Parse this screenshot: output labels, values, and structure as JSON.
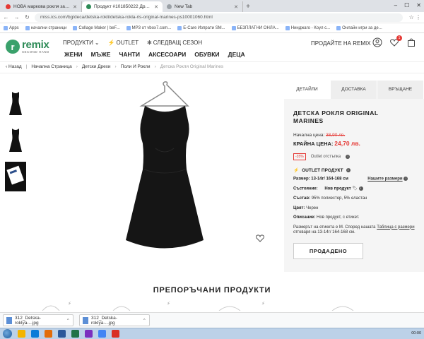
{
  "browser": {
    "tabs": [
      {
        "label": "НОВА маркова рокля за момиче",
        "favicon": "red",
        "active": false
      },
      {
        "label": "Продукт #101850222 Дрехи ат...",
        "favicon": "green",
        "active": true
      },
      {
        "label": "New Tab",
        "favicon": "grey",
        "active": false
      }
    ],
    "url": "miss.ics.com/bg/deca/detska-rokli/detska-rokla-ris-original-marines-ps10001060.html",
    "bookmarks": [
      "Apps",
      "начални страници",
      "Collage Maker | beF...",
      "MP3 от vbox7.com...",
      "E-Care Изпрати SM...",
      "БЕЗПЛАТНИ ОНЛА...",
      "Нинджаго - Коул с...",
      "Онлайн игри за де..."
    ]
  },
  "header": {
    "logo_name": "remix",
    "logo_sub": "SECOND HAND",
    "top_links": [
      "ПРОДУКТИ",
      "OUTLET",
      "СЛЕДВАЩ СЕЗОН"
    ],
    "categories": [
      "ЖЕНИ",
      "МЪЖЕ",
      "ЧАНТИ",
      "АКСЕСОАРИ",
      "ОБУВКИ",
      "ДЕЦА"
    ],
    "sell_label": "ПРОДАЙТЕ НА REMIX",
    "wishlist_count": "1"
  },
  "breadcrumb": {
    "back": "Назад",
    "items": [
      "Начална Страница",
      "Детски Дрехи",
      "Поли И Рокли"
    ],
    "current": "Детска Рокля Original Marines"
  },
  "product": {
    "tabs": [
      "ДЕТАЙЛИ",
      "ДОСТАВКА",
      "ВРЪЩАНЕ"
    ],
    "title": "ДЕТСКА РОКЛЯ ORIGINAL MARINES",
    "initial_price_label": "Начална цена:",
    "initial_price": "38,90 лв.",
    "final_price_label": "КРАЙНА ЦЕНА:",
    "final_price": "24,70 лв.",
    "discount_badge": "-35%",
    "discount_text": "Outlet отстъпка",
    "outlet_label": "OUTLET ПРОДУКТ",
    "size_label": "Размер:",
    "size_value": "13-14г/ 164-168 см",
    "size_link": "Нашите размери",
    "condition_label": "Състояние:",
    "condition_value": "Нов продукт",
    "composition_label": "Състав:",
    "composition_value": "95% полиестер, 5% еластан",
    "color_label": "Цвят:",
    "color_value": "Черен",
    "description_label": "Описание:",
    "description_value": "Нов продукт, с етикет.",
    "size_note_a": "Размерът на етикета е M. Според нашата",
    "size_note_link": "Таблица с размери",
    "size_note_b": "отговаря на 13-14г/ 164-168 см.",
    "sold_label": "ПРОДАДЕНО"
  },
  "recommended": {
    "title": "ПРЕПОРЪЧАНИ ПРОДУКТИ"
  },
  "downloads": [
    "312_Detska-roklya-...jpg",
    "312_Detska-roklya-...jpg"
  ],
  "taskbar": {
    "time": "00:00"
  },
  "colors": {
    "brand": "#2e8b57",
    "price_red": "#e53935",
    "panel_bg": "#f5f5f5"
  }
}
